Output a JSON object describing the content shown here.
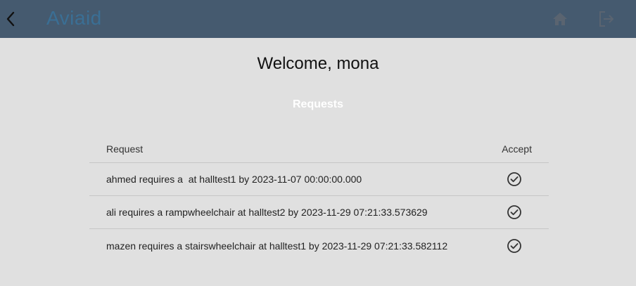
{
  "appbar": {
    "logo_text": "Aviaid",
    "icons": {
      "back": "chevron-left-icon",
      "home": "home-icon",
      "logout": "logout-icon"
    },
    "colors": {
      "background": "#455a6f",
      "logo": "#3a6f95",
      "icon": "#5a6b7a"
    }
  },
  "main": {
    "welcome": "Welcome, mona",
    "section_title": "Requests",
    "table": {
      "headers": {
        "request": "Request",
        "accept": "Accept"
      },
      "rows": [
        {
          "request": "ahmed requires a  at halltest1 by 2023-11-07 00:00:00.000"
        },
        {
          "request": "ali requires a rampwheelchair at halltest2 by 2023-11-29 07:21:33.573629"
        },
        {
          "request": "mazen requires a stairswheelchair at halltest1 by 2023-11-29 07:21:33.582112"
        }
      ],
      "accept_icon": "check-circle-icon"
    }
  }
}
